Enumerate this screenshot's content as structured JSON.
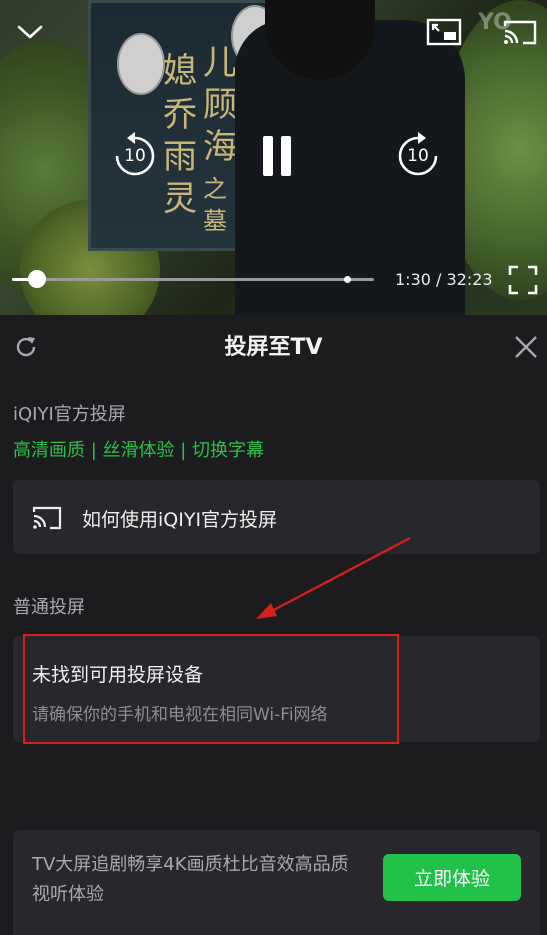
{
  "player": {
    "time": "1:30 / 32:23",
    "progress": 0.07,
    "buffered": 0.93,
    "rewind_label": "10",
    "forward_label": "10",
    "stone_text": [
      "儿",
      "媳",
      "顾",
      "乔",
      "海",
      "雨",
      "灵",
      "之",
      "墓"
    ],
    "watermark": "YO"
  },
  "panel": {
    "title": "投屏至TV",
    "official_section": "iQIYI官方投屏",
    "features": "高清画质 | 丝滑体验 | 切换字幕",
    "official_card_label": "如何使用iQIYI官方投屏",
    "normal_section": "普通投屏",
    "normal_title": "未找到可用投屏设备",
    "normal_hint": "请确保你的手机和电视在相同Wi-Fi网络"
  },
  "promo": {
    "text": "TV大屏追剧畅享4K画质杜比音效高品质视听体验",
    "button": "立即体验"
  },
  "colors": {
    "accent_green": "#22c24a",
    "annotation_red": "#d6201e",
    "panel_bg": "#1c1c1f",
    "card_bg": "#28282c"
  },
  "icons": [
    "chevron-down-icon",
    "pip-icon",
    "cast-icon",
    "rewind-10-icon",
    "pause-icon",
    "forward-10-icon",
    "fullscreen-icon",
    "refresh-icon",
    "close-icon",
    "cast-screen-icon"
  ]
}
